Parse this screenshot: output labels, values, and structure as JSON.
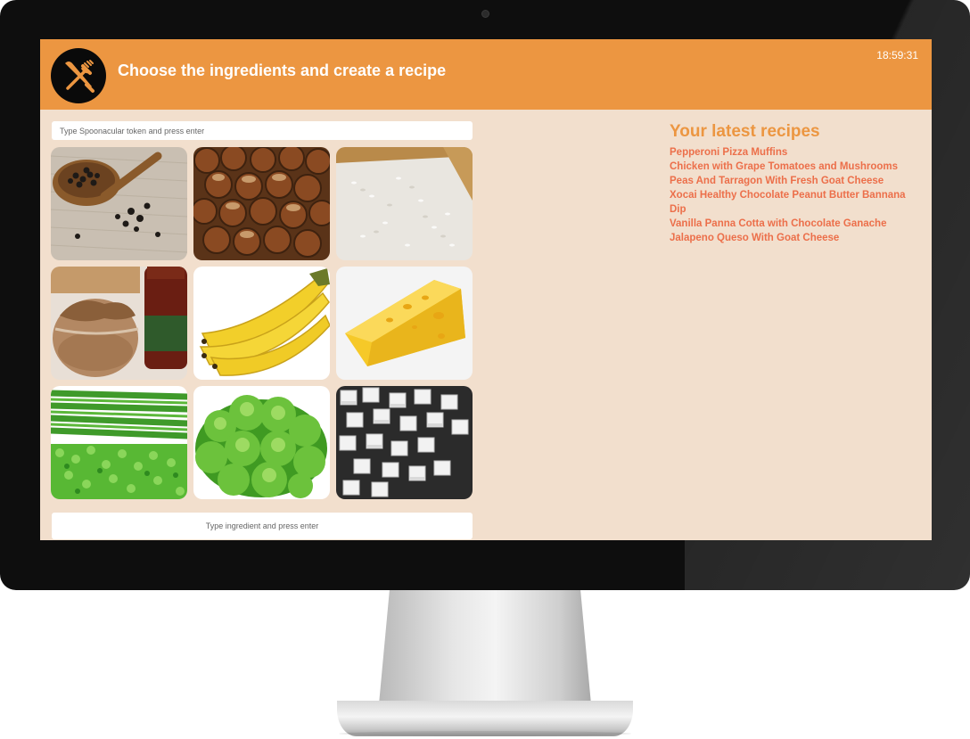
{
  "header": {
    "title": "Choose the ingredients and create a recipe",
    "clock": "18:59:31",
    "logo_icon": "fork-knife-icon"
  },
  "token_input": {
    "placeholder": "Type Spoonacular token and press enter",
    "value": ""
  },
  "ingredients": [
    "peppercorns",
    "hazelnuts",
    "rice",
    "peanut-butter",
    "bananas",
    "cheese",
    "green-onions",
    "lettuce",
    "sugar-cubes"
  ],
  "ingredient_input": {
    "placeholder": "Type ingredient and press enter",
    "value": ""
  },
  "recipes": {
    "title": "Your latest recipes",
    "items": [
      "Pepperoni Pizza Muffins",
      "Chicken with Grape Tomatoes and Mushrooms",
      "Peas And Tarragon With Fresh Goat Cheese",
      "Xocai Healthy Chocolate Peanut Butter Bannana Dip",
      "Vanilla Panna Cotta with Chocolate Ganache",
      "Jalapeno Queso With Goat Cheese"
    ]
  },
  "colors": {
    "accent": "#ec9641",
    "background": "#f2dfcd",
    "recipe_link": "#ec6f4a",
    "bezel": "#0e0e0e"
  }
}
